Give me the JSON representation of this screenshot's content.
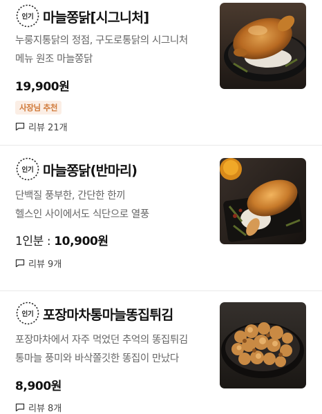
{
  "items": [
    {
      "badge": "인기",
      "title": "마늘쫑닭[시그니처]",
      "desc1": "누룽지통닭의 정점, 구도로통닭의 시그니처",
      "desc2": "메뉴 원조 마늘쫑닭",
      "price": "19,900원",
      "tag": "사장님 추천",
      "review": "리뷰 21개",
      "image": "roast-chicken-rice-platter"
    },
    {
      "badge": "인기",
      "title": "마늘쫑닭(반마리)",
      "desc1": "단백질 풍부한, 간단한 한끼",
      "desc2": "헬스인 사이에서도 식단으로 열풍",
      "portion": "1인분 : ",
      "price": "10,900원",
      "review": "리뷰 9개",
      "image": "half-roast-chicken-platter"
    },
    {
      "badge": "인기",
      "title": "포장마차통마늘똥집튀김",
      "desc1": "포장마차에서 자주 먹었던 추억의 똥집튀김",
      "desc2": "통마늘 풍미와 바삭쫄깃한 똥집이 만났다",
      "price": "8,900원",
      "review": "리뷰 8개",
      "image": "fried-gizzard-garlic-bowl"
    }
  ],
  "colors": {
    "tag_bg": "#fbeee5",
    "tag_text": "#d07a3a",
    "divider": "#e9e9e9"
  }
}
